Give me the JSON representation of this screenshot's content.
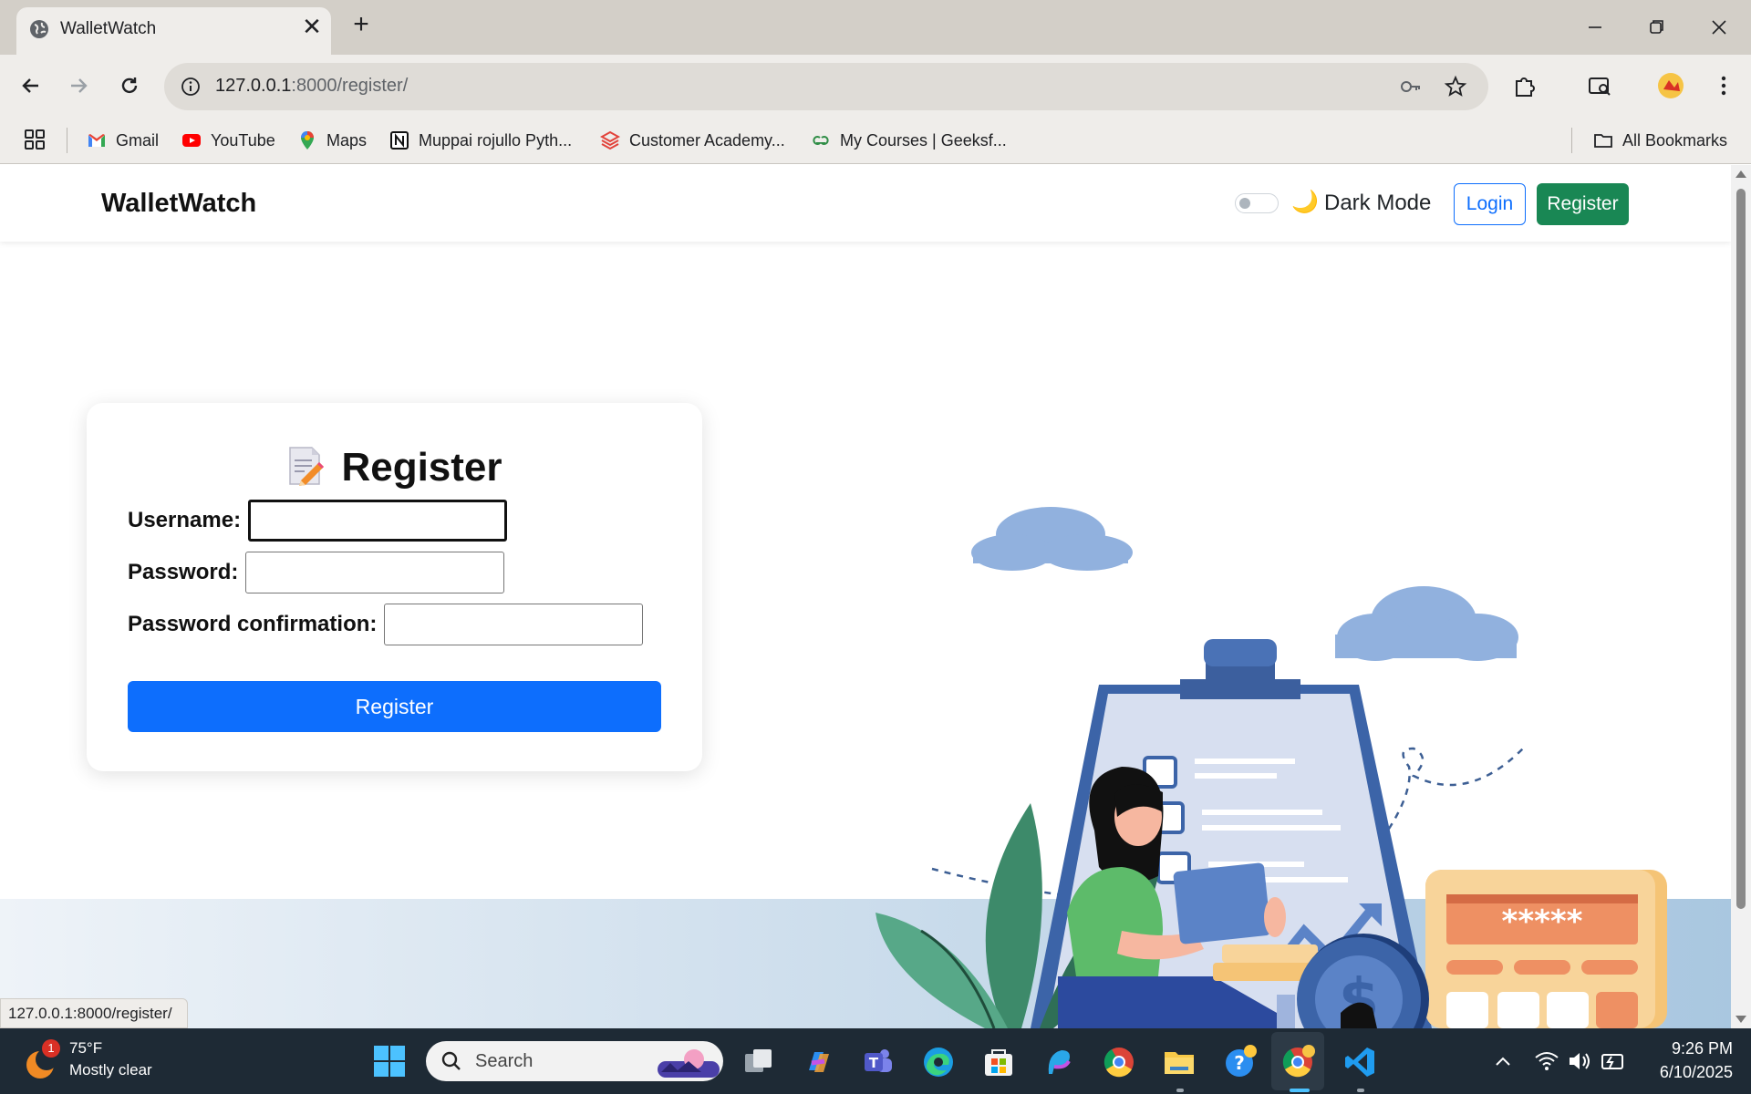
{
  "browser": {
    "tab_title": "WalletWatch",
    "new_tab_symbol": "+",
    "close_symbol": "✕",
    "url_host": "127.0.0.1",
    "url_path": ":8000/register/",
    "bookmarks": [
      {
        "label": "Gmail",
        "icon": "gmail-icon"
      },
      {
        "label": "YouTube",
        "icon": "youtube-icon"
      },
      {
        "label": "Maps",
        "icon": "maps-icon"
      },
      {
        "label": "Muppai rojullo Pyth...",
        "icon": "notion-icon"
      },
      {
        "label": "Customer Academy...",
        "icon": "layers-icon"
      },
      {
        "label": "My Courses | Geeksf...",
        "icon": "geeksforgeeks-icon"
      }
    ],
    "all_bookmarks_label": "All Bookmarks",
    "status_url": "127.0.0.1:8000/register/"
  },
  "navbar": {
    "brand": "WalletWatch",
    "dark_mode_emoji": "🌙",
    "dark_mode_label": "Dark Mode",
    "login_label": "Login",
    "register_label": "Register"
  },
  "form": {
    "title": "Register",
    "title_icon": "memo-icon",
    "fields": [
      {
        "label": "Username:",
        "value": ""
      },
      {
        "label": "Password:",
        "value": ""
      },
      {
        "label": "Password confirmation:",
        "value": ""
      }
    ],
    "submit_label": "Register",
    "calculator_display": "*****"
  },
  "taskbar": {
    "weather_temp": "75°F",
    "weather_desc": "Mostly clear",
    "weather_badge": "1",
    "search_placeholder": "Search",
    "time": "9:26 PM",
    "date": "6/10/2025"
  },
  "colors": {
    "primary": "#0d6efd",
    "success": "#198754",
    "taskbar": "#1e2a35"
  }
}
